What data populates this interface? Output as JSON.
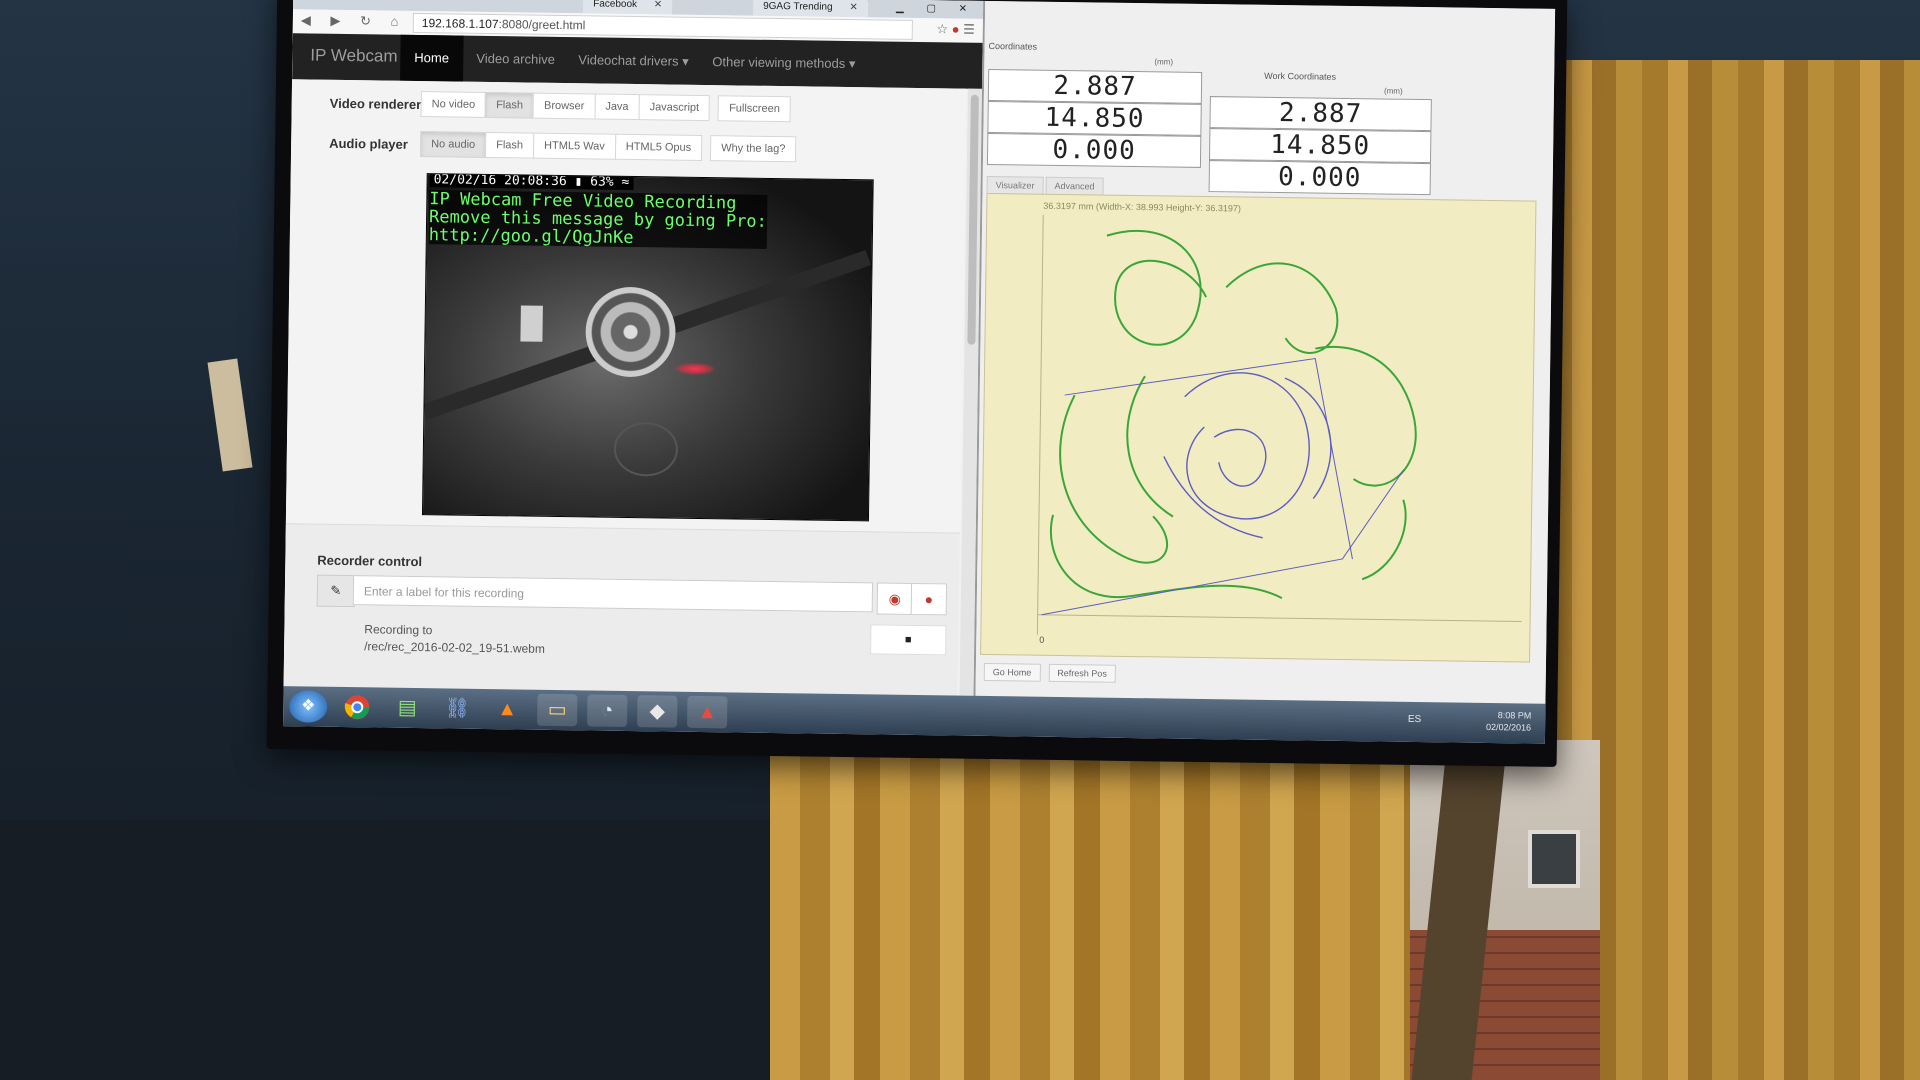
{
  "browser": {
    "tabs": [
      {
        "label": "Facebook"
      },
      {
        "label": "9GAG Trending"
      }
    ],
    "url": {
      "host": "192.168.1.107",
      "path": ":8080/greet.html"
    }
  },
  "navbar": {
    "brand": "IP Webcam",
    "items": [
      {
        "label": "Home"
      },
      {
        "label": "Video archive"
      },
      {
        "label": "Videochat drivers ▾"
      },
      {
        "label": "Other viewing methods ▾"
      }
    ]
  },
  "video_renderer": {
    "label": "Video renderer",
    "options": [
      "No video",
      "Flash",
      "Browser",
      "Java",
      "Javascript",
      "Fullscreen"
    ],
    "selected": "Flash"
  },
  "audio_player": {
    "label": "Audio player",
    "options": [
      "No audio",
      "Flash",
      "HTML5 Wav",
      "HTML5 Opus",
      "Why the lag?"
    ],
    "selected": "No audio"
  },
  "video": {
    "timestamp": "02/02/16 20:08:36 ▮ 63% ≈",
    "overlay_lines": [
      "IP Webcam Free Video Recording",
      "Remove this message by going Pro:",
      "http://goo.gl/QgJnKe"
    ]
  },
  "recorder": {
    "title": "Recorder control",
    "placeholder": "Enter a label for this recording",
    "status_line1": "Recording to",
    "status_line2": "/rec/rec_2016-02-02_19-51.webm"
  },
  "cnc": {
    "machine_header": "Coordinates",
    "work_header": "Work Coordinates",
    "unit": "(mm)",
    "machine": [
      "2.887",
      "14.850",
      "0.000"
    ],
    "work": [
      "2.887",
      "14.850",
      "0.000"
    ],
    "tabs": [
      "Visualizer",
      "Advanced"
    ],
    "dims": "36.3197 mm  (Width-X: 38.993  Height-Y: 36.3197)",
    "origin": "0",
    "buttons": [
      "Go Home",
      "Refresh Pos"
    ],
    "colors": {
      "path_green": "#3aa63a",
      "path_blue": "#5d5cc2",
      "canvas": "#f2ecc2"
    }
  },
  "taskbar": {
    "icons": [
      "windows-start-icon",
      "chrome-icon",
      "notepad-icon",
      "network-icon",
      "vlc-icon",
      "folder-icon",
      "app-icon",
      "inkscape-icon",
      "cnc-app-icon"
    ],
    "lang": "ES",
    "time": "8:08 PM",
    "date": "02/02/2016"
  }
}
